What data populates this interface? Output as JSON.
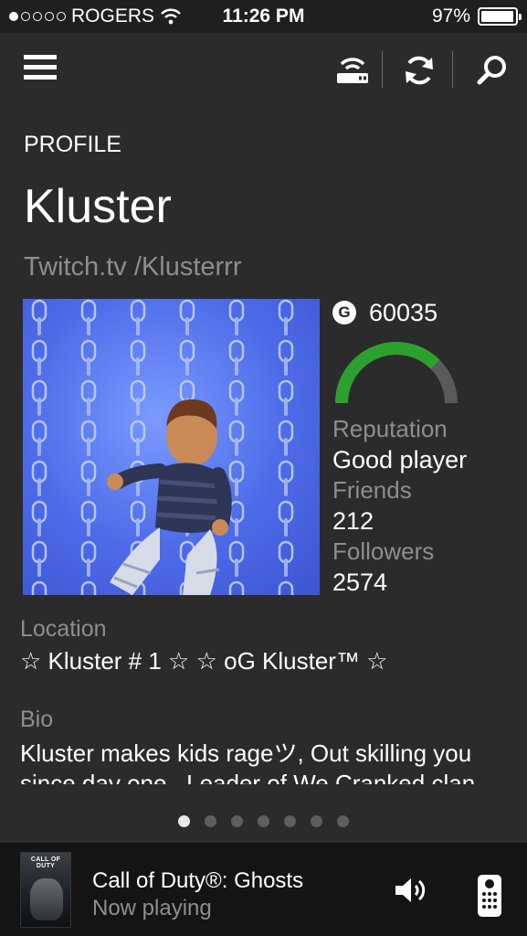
{
  "status_bar": {
    "carrier": "ROGERS",
    "time": "11:26 PM",
    "battery": "97%",
    "battery_level": 0.97,
    "signal_bars": 1
  },
  "app_bar": {
    "icons": [
      "menu-icon",
      "wifi-router-icon",
      "refresh-icon",
      "search-icon"
    ]
  },
  "profile": {
    "section_label": "PROFILE",
    "gamertag": "Kluster",
    "motto": "Twitch.tv /Klusterrr",
    "gamerscore": "60035",
    "gamerscore_badge": "G",
    "reputation_label": "Reputation",
    "reputation_value": "Good player",
    "reputation_level": 0.75,
    "friends_label": "Friends",
    "friends_count": "212",
    "followers_label": "Followers",
    "followers_count": "2574",
    "location_label": "Location",
    "location_value": "☆ Kluster # 1 ☆ ☆ oG Kluster™ ☆",
    "bio_label": "Bio",
    "bio_value": "Kluster makes kids rageツ, Out skilling you since day one . Leader of We Cranked clan"
  },
  "pager": {
    "count": 7,
    "active_index": 0
  },
  "now_playing": {
    "title": "Call of Duty®: Ghosts",
    "status": "Now playing",
    "box_art_text": "CALL OF DUTY"
  },
  "colors": {
    "background": "#2b2b2b",
    "accent_green": "#2ca02c",
    "gauge_track": "#5a5a5a",
    "muted_text": "#8e8e8e"
  }
}
